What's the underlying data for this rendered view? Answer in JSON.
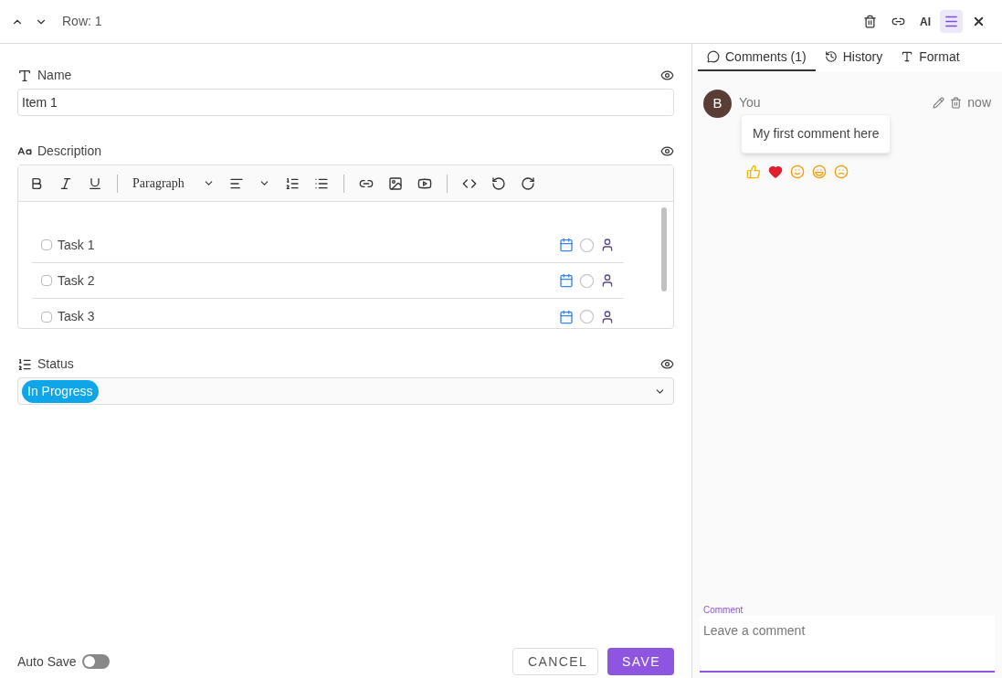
{
  "header": {
    "row_label": "Row: 1",
    "ai_label": "AI",
    "menu_selected": true
  },
  "name_field": {
    "label": "Name",
    "value": "Item 1"
  },
  "description": {
    "label": "Description",
    "block_style": "Paragraph",
    "tasks": [
      {
        "text": "Task 1",
        "checked": false
      },
      {
        "text": "Task 2",
        "checked": false
      },
      {
        "text": "Task 3",
        "checked": false
      }
    ]
  },
  "status": {
    "label": "Status",
    "value": "In Progress",
    "color": "#0ea5e9"
  },
  "footer": {
    "auto_save": {
      "label": "Auto Save",
      "on": false
    },
    "buttons": [
      {
        "label": "CANCEL",
        "kind": "outline"
      },
      {
        "label": "SAVE",
        "kind": "primary"
      }
    ]
  },
  "tabs": [
    {
      "label": "Comments (1)",
      "selected": true,
      "kind": "comments"
    },
    {
      "label": "History",
      "selected": false,
      "kind": "history"
    },
    {
      "label": "Format",
      "selected": false,
      "kind": "format"
    }
  ],
  "comments": [
    {
      "avatar": "B",
      "author": "You",
      "time": "now",
      "text": "My first comment here"
    }
  ],
  "comment_field": {
    "label": "Comment",
    "placeholder": "Leave a comment"
  }
}
